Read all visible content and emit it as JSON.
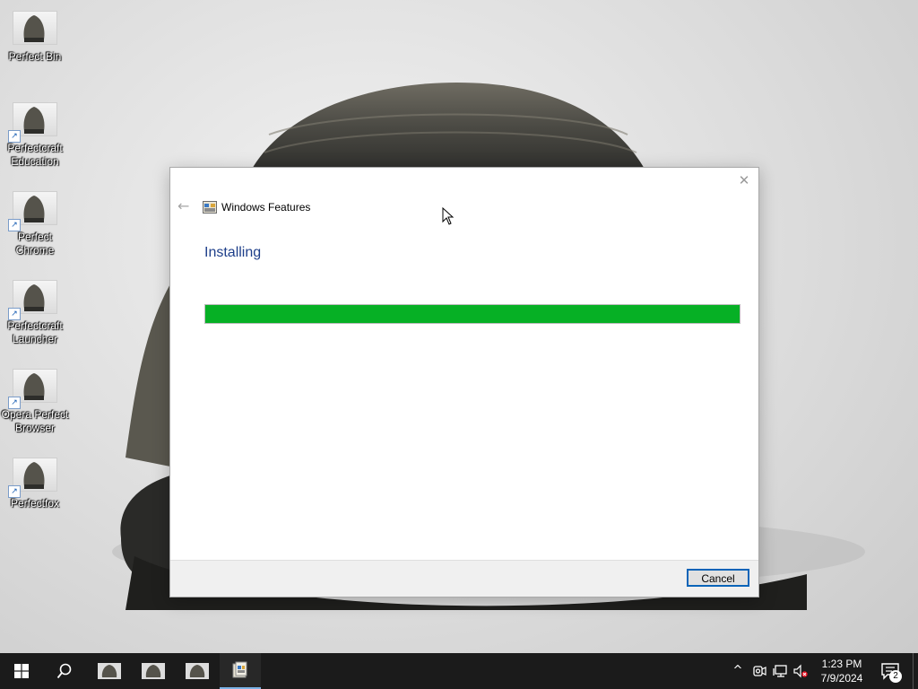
{
  "desktop": {
    "icons": [
      {
        "label": "Perfect Bin",
        "shortcut": false
      },
      {
        "label": "Perfectcraft Education",
        "shortcut": true
      },
      {
        "label": "Perfect Chrome",
        "shortcut": true
      },
      {
        "label": "Perfectcraft Launcher",
        "shortcut": true
      },
      {
        "label": "Opera Perfect Browser",
        "shortcut": true
      },
      {
        "label": "Perfectfox",
        "shortcut": true
      }
    ]
  },
  "dialog": {
    "title": "Windows Features",
    "heading": "Installing",
    "progress_percent": 100,
    "progress_color": "#06b025",
    "cancel_label": "Cancel",
    "close_glyph": "✕",
    "back_glyph": "←"
  },
  "taskbar": {
    "apps": [
      "start-icon",
      "search-icon",
      "app-sculpture-1",
      "app-sculpture-2",
      "app-sculpture-3",
      "windows-features-app"
    ],
    "tray_chevron": "^",
    "time": "1:23 PM",
    "date": "7/9/2024",
    "notification_count": "2"
  }
}
